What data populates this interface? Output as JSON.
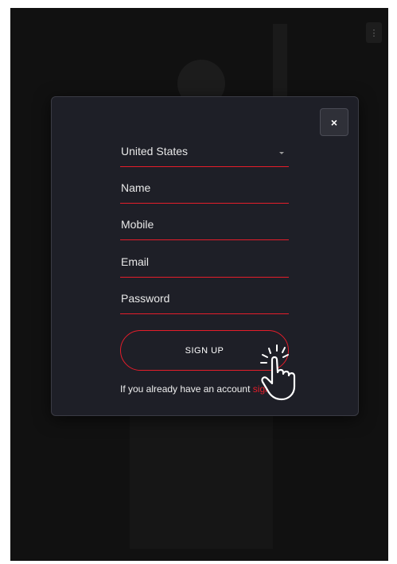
{
  "topbar": {
    "menu_label": "⋮"
  },
  "modal": {
    "close_label": "×",
    "country": {
      "value": "United States"
    },
    "fields": {
      "name": "Name",
      "mobile": "Mobile",
      "email": "Email",
      "password": "Password"
    },
    "signup_label": "SIGN UP",
    "signin_prompt": "If you already have an account ",
    "signin_link": "sign in"
  },
  "colors": {
    "accent": "#e51d2a",
    "modal_bg": "#1e1f27",
    "page_bg": "#111111"
  },
  "icons": [
    "close-icon",
    "chevron-down-icon",
    "hand-pointer-icon"
  ]
}
